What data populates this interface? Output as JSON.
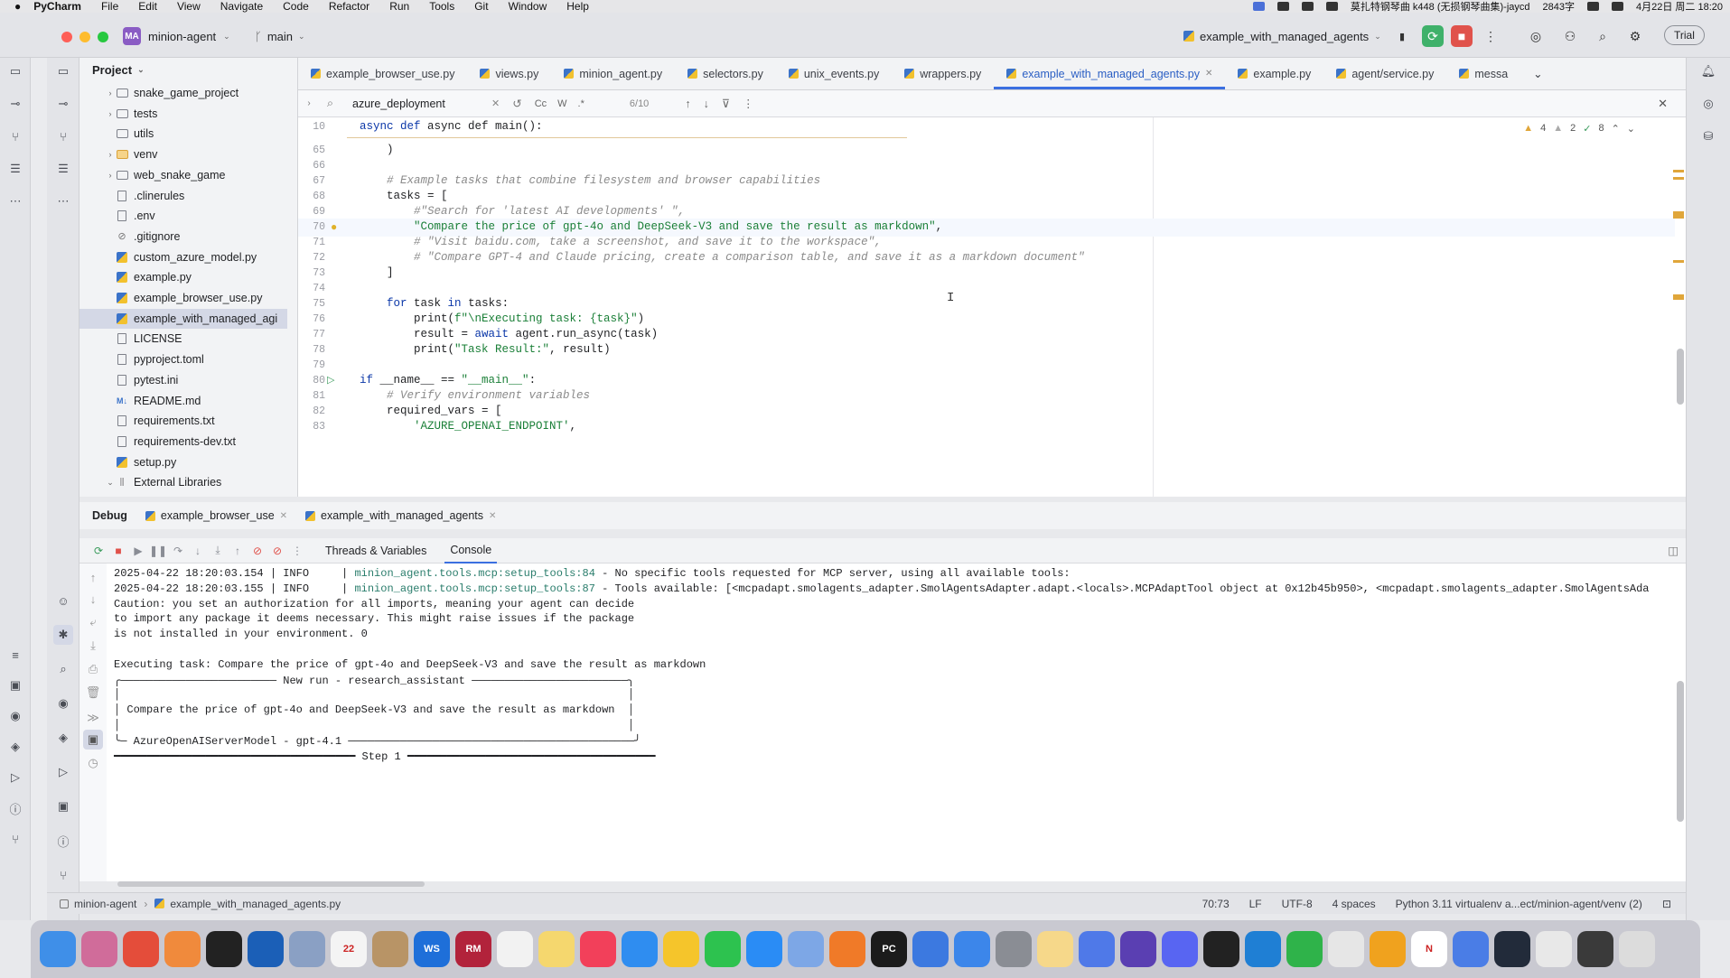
{
  "menubar": {
    "apple": "",
    "app": "PyCharm",
    "items": [
      "File",
      "Edit",
      "View",
      "Navigate",
      "Code",
      "Refactor",
      "Run",
      "Tools",
      "Git",
      "Window",
      "Help"
    ],
    "right_text": "莫扎特钢琴曲 k448 (无损钢琴曲集)-jaycd",
    "speed": "2843字",
    "datetime": "4月22日 周二 18:20"
  },
  "toolbar": {
    "project_badge": "MA",
    "project_name": "minion-agent",
    "branch": "main",
    "run_config": "example_with_managed_agents",
    "trial": "Trial"
  },
  "project_panel": {
    "title": "Project",
    "items": [
      {
        "label": "snake_game_project",
        "kind": "folder",
        "arrow": "›"
      },
      {
        "label": "tests",
        "kind": "folder",
        "arrow": "›"
      },
      {
        "label": "utils",
        "kind": "folder",
        "arrow": ""
      },
      {
        "label": "venv",
        "kind": "folder-orange",
        "arrow": "›"
      },
      {
        "label": "web_snake_game",
        "kind": "folder",
        "arrow": "›"
      },
      {
        "label": ".clinerules",
        "kind": "text",
        "arrow": ""
      },
      {
        "label": ".env",
        "kind": "text",
        "arrow": ""
      },
      {
        "label": ".gitignore",
        "kind": "ignore",
        "arrow": ""
      },
      {
        "label": "custom_azure_model.py",
        "kind": "py",
        "arrow": ""
      },
      {
        "label": "example.py",
        "kind": "py",
        "arrow": ""
      },
      {
        "label": "example_browser_use.py",
        "kind": "py",
        "arrow": ""
      },
      {
        "label": "example_with_managed_agi",
        "kind": "py",
        "arrow": "",
        "selected": true
      },
      {
        "label": "LICENSE",
        "kind": "text",
        "arrow": ""
      },
      {
        "label": "pyproject.toml",
        "kind": "text",
        "arrow": ""
      },
      {
        "label": "pytest.ini",
        "kind": "text",
        "arrow": ""
      },
      {
        "label": "README.md",
        "kind": "md",
        "arrow": ""
      },
      {
        "label": "requirements.txt",
        "kind": "text",
        "arrow": ""
      },
      {
        "label": "requirements-dev.txt",
        "kind": "text",
        "arrow": ""
      },
      {
        "label": "setup.py",
        "kind": "py",
        "arrow": ""
      },
      {
        "label": "External Libraries",
        "kind": "lib",
        "arrow": "⌄"
      }
    ]
  },
  "editor_tabs": [
    {
      "label": "example_browser_use.py",
      "active": false
    },
    {
      "label": "views.py",
      "active": false
    },
    {
      "label": "minion_agent.py",
      "active": false
    },
    {
      "label": "selectors.py",
      "active": false
    },
    {
      "label": "unix_events.py",
      "active": false
    },
    {
      "label": "wrappers.py",
      "active": false
    },
    {
      "label": "example_with_managed_agents.py",
      "active": true
    },
    {
      "label": "example.py",
      "active": false
    },
    {
      "label": "agent/service.py",
      "active": false
    },
    {
      "label": "messa",
      "active": false
    }
  ],
  "find": {
    "query": "azure_deployment",
    "options": [
      "Cc",
      "W",
      ".*"
    ],
    "count": "6/10"
  },
  "inspections": {
    "warnings": "4",
    "weak": "2",
    "ok": "8"
  },
  "code": {
    "sticky": {
      "num": "10",
      "text": "async def main():"
    },
    "lines": [
      {
        "num": "65",
        "html": "    )"
      },
      {
        "num": "66",
        "html": ""
      },
      {
        "num": "67",
        "html": "    <span class='cmt'># Example tasks that combine filesystem and browser capabilities</span>"
      },
      {
        "num": "68",
        "html": "    tasks = ["
      },
      {
        "num": "69",
        "html": "        <span class='cmt'>#\"Search for 'latest AI developments' \",</span>"
      },
      {
        "num": "70",
        "html": "        <span class='str'>\"Compare the price of gpt-4o and DeepSeek-V3 and save the result as markdown\"</span>,",
        "current": true
      },
      {
        "num": "71",
        "html": "        <span class='cmt'># \"Visit baidu.com, take a screenshot, and save it to the workspace\",</span>"
      },
      {
        "num": "72",
        "html": "        <span class='cmt'># \"Compare GPT-4 and Claude pricing, create a comparison table, and save it as a markdown document\"</span>"
      },
      {
        "num": "73",
        "html": "    ]"
      },
      {
        "num": "74",
        "html": ""
      },
      {
        "num": "75",
        "html": "    <span class='kw'>for</span> task <span class='kw'>in</span> tasks:"
      },
      {
        "num": "76",
        "html": "        print(<span class='fstr'>f\"\\nExecuting task: {task}\"</span>)"
      },
      {
        "num": "77",
        "html": "        result = <span class='kw'>await</span> agent.run_async(task)"
      },
      {
        "num": "78",
        "html": "        print(<span class='str'>\"Task Result:\"</span>, result)"
      },
      {
        "num": "79",
        "html": ""
      },
      {
        "num": "80",
        "html": "<span class='kw'>if</span> __name__ == <span class='str'>\"__main__\"</span>:"
      },
      {
        "num": "81",
        "html": "    <span class='cmt'># Verify environment variables</span>"
      },
      {
        "num": "82",
        "html": "    required_vars = ["
      },
      {
        "num": "83",
        "html": "        <span class='str'>'AZURE_OPENAI_ENDPOINT'</span>,"
      }
    ]
  },
  "debug": {
    "label": "Debug",
    "tabs": [
      "example_browser_use",
      "example_with_managed_agents"
    ],
    "subtabs": [
      "Threads & Variables",
      "Console"
    ]
  },
  "console_lines": [
    {
      "ts": "2025-04-22 18:20:03.154 | INFO     | ",
      "src": "minion_agent.tools.mcp:setup_tools:84",
      "msg": " - No specific tools requested for MCP server, using all available tools:"
    },
    {
      "ts": "2025-04-22 18:20:03.155 | INFO     | ",
      "src": "minion_agent.tools.mcp:setup_tools:87",
      "msg": " - Tools available: [<mcpadapt.smolagents_adapter.SmolAgentsAdapter.adapt.<locals>.MCPAdaptTool object at 0x12b45b950>, <mcpadapt.smolagents_adapter.SmolAgentsAda"
    },
    {
      "ts": "",
      "src": "",
      "msg": "Caution: you set an authorization for all imports, meaning your agent can decide"
    },
    {
      "ts": "",
      "src": "",
      "msg": "to import any package it deems necessary. This might raise issues if the package"
    },
    {
      "ts": "",
      "src": "",
      "msg": "is not installed in your environment. 0"
    },
    {
      "ts": "",
      "src": "",
      "msg": ""
    },
    {
      "ts": "",
      "src": "",
      "msg": "Executing task: Compare the price of gpt-4o and DeepSeek-V3 and save the result as markdown"
    },
    {
      "ts": "",
      "src": "",
      "msg": "╭──────────────────────── New run - research_assistant ────────────────────────╮"
    },
    {
      "ts": "",
      "src": "",
      "msg": "│                                                                              │"
    },
    {
      "ts": "",
      "src": "",
      "msg": "│ Compare the price of gpt-4o and DeepSeek-V3 and save the result as markdown  │"
    },
    {
      "ts": "",
      "src": "",
      "msg": "│                                                                              │"
    },
    {
      "ts": "",
      "src": "",
      "msg": "╰─ AzureOpenAIServerModel - gpt-4.1 ────────────────────────────────────────────╯"
    },
    {
      "ts": "",
      "src": "",
      "msg": "━━━━━━━━━━━━━━━━━━━━━━━━━━━━━━━━━━━━━ Step 1 ━━━━━━━━━━━━━━━━━━━━━━━━━━━━━━━━━━━━━━"
    }
  ],
  "status": {
    "crumb_project": "minion-agent",
    "crumb_file": "example_with_managed_agents.py",
    "position": "70:73",
    "line_sep": "LF",
    "encoding": "UTF-8",
    "indent": "4 spaces",
    "interpreter": "Python 3.11 virtualenv a...ect/minion-agent/venv (2)"
  },
  "dock": [
    {
      "name": "finder",
      "color": "#3f8fe8",
      "glyph": ""
    },
    {
      "name": "launchpad",
      "color": "#d06c9a",
      "glyph": ""
    },
    {
      "name": "chrome",
      "color": "#e44d3a",
      "glyph": ""
    },
    {
      "name": "photos",
      "color": "#f08a3c",
      "glyph": ""
    },
    {
      "name": "terminal",
      "color": "#222",
      "glyph": ""
    },
    {
      "name": "app",
      "color": "#1b5fb7",
      "glyph": ""
    },
    {
      "name": "preview",
      "color": "#8aa0c4",
      "glyph": ""
    },
    {
      "name": "calendar",
      "color": "#f4f4f4",
      "glyph": "22"
    },
    {
      "name": "app2",
      "color": "#b89466",
      "glyph": ""
    },
    {
      "name": "webstorm",
      "color": "#1e6fd9",
      "glyph": "WS"
    },
    {
      "name": "rubymine",
      "color": "#b2233b",
      "glyph": "RM"
    },
    {
      "name": "reminders",
      "color": "#f2f2f2",
      "glyph": ""
    },
    {
      "name": "notes",
      "color": "#f5d76e",
      "glyph": ""
    },
    {
      "name": "music",
      "color": "#f2405a",
      "glyph": ""
    },
    {
      "name": "safari",
      "color": "#2f8df0",
      "glyph": ""
    },
    {
      "name": "app3",
      "color": "#f5c52b",
      "glyph": ""
    },
    {
      "name": "wechat",
      "color": "#2dc24f",
      "glyph": ""
    },
    {
      "name": "appstore",
      "color": "#2a8cf5",
      "glyph": ""
    },
    {
      "name": "app4",
      "color": "#7da7e6",
      "glyph": ""
    },
    {
      "name": "firefox",
      "color": "#f07a28",
      "glyph": ""
    },
    {
      "name": "pycharm",
      "color": "#1b1b1b",
      "glyph": "PC"
    },
    {
      "name": "app5",
      "color": "#3c79e0",
      "glyph": ""
    },
    {
      "name": "app6",
      "color": "#3c86ea",
      "glyph": ""
    },
    {
      "name": "settings",
      "color": "#8a8d94",
      "glyph": ""
    },
    {
      "name": "app7",
      "color": "#f6d88a",
      "glyph": ""
    },
    {
      "name": "app8",
      "color": "#4f79e8",
      "glyph": ""
    },
    {
      "name": "app9",
      "color": "#5a3fb2",
      "glyph": ""
    },
    {
      "name": "discord",
      "color": "#5865f2",
      "glyph": ""
    },
    {
      "name": "app10",
      "color": "#222",
      "glyph": ""
    },
    {
      "name": "vscode",
      "color": "#1f7fd4",
      "glyph": ""
    },
    {
      "name": "numbers",
      "color": "#2fb34a",
      "glyph": ""
    },
    {
      "name": "slack",
      "color": "#e6e6e6",
      "glyph": ""
    },
    {
      "name": "app11",
      "color": "#f0a21e",
      "glyph": ""
    },
    {
      "name": "notion",
      "color": "#ffffff",
      "glyph": "N"
    },
    {
      "name": "app12",
      "color": "#4a7de6",
      "glyph": ""
    },
    {
      "name": "app13",
      "color": "#222b3a",
      "glyph": ""
    },
    {
      "name": "doc",
      "color": "#e8e8e8",
      "glyph": ""
    },
    {
      "name": "app14",
      "color": "#3a3a3a",
      "glyph": ""
    },
    {
      "name": "trash",
      "color": "#dcdcdc",
      "glyph": ""
    }
  ]
}
